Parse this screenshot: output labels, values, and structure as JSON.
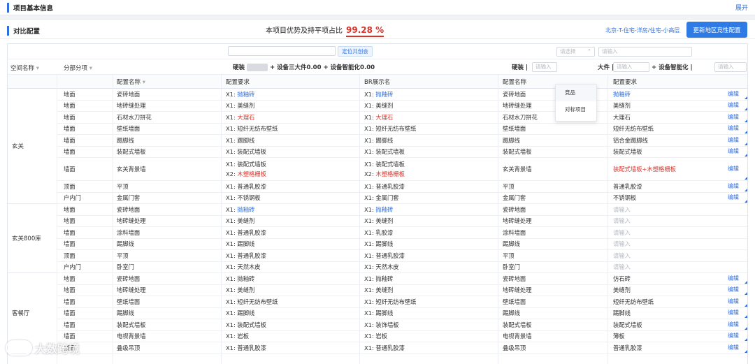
{
  "section": {
    "title": "项目基本信息",
    "expand_label": "展开"
  },
  "compare": {
    "title": "对比配置",
    "ratio_label": "本项目优势及持平项占比",
    "ratio_value": "99.28",
    "ratio_unit": "%",
    "region_link": "北京-T-住宅-洋房/住宅-小高层",
    "update_button": "更新地区竞性配置"
  },
  "filters": {
    "left_input_placeholder": "",
    "locate_button": "定位共创会",
    "select_placeholder": "请选择",
    "right_input_placeholder": "请输入"
  },
  "summary": {
    "left": "硬装",
    "left_rest": "+ 设备三大件0.00 + 设备智能化0.00",
    "right_hard": "硬装 |",
    "right_hard_input": "请输入",
    "right_mid": "大件 |",
    "right_mid_input": "请输入",
    "right_smart": "+ 设备智能化 |",
    "right_smart_input": "请输入"
  },
  "dropdown": {
    "options": [
      "竞品",
      "对标项目"
    ]
  },
  "columns": {
    "space": "空间名称",
    "part": "分部分项",
    "name": "配置名称",
    "req": "配置要求",
    "br": "BR展示名",
    "cmp_name": "配置名称",
    "cmp_req": "配置要求"
  },
  "groups": [
    {
      "space": "玄关",
      "rows": [
        {
          "part": "地面",
          "name": "瓷砖地面",
          "req": [
            "X1: 抛釉砖"
          ],
          "br": [
            "X1: 抛釉砖"
          ],
          "cmp_name": "瓷砖地面",
          "cmp_req": "抛釉砖",
          "tone": "blue",
          "edit": "编辑"
        },
        {
          "part": "地面",
          "name": "地砖缝处理",
          "req": [
            "X1: 美缝剂"
          ],
          "br": [
            "X1: 美缝剂"
          ],
          "cmp_name": "地砖缝处理",
          "cmp_req": "美缝剂",
          "tone": "",
          "edit": "编辑"
        },
        {
          "part": "地面",
          "name": "石材水刀拼花",
          "req": [
            "X1: 大理石"
          ],
          "br": [
            "X1: 大理石"
          ],
          "cmp_name": "石材水刀拼花",
          "cmp_req": "大理石",
          "tone": "red",
          "edit": "编辑"
        },
        {
          "part": "墙面",
          "name": "壁纸墙面",
          "req": [
            "X1: 短纤无纺布壁纸"
          ],
          "br": [
            "X1: 短纤无纺布壁纸"
          ],
          "cmp_name": "壁纸墙面",
          "cmp_req": "短纤无纺布壁纸",
          "tone": "",
          "edit": "编辑"
        },
        {
          "part": "墙面",
          "name": "踢脚线",
          "req": [
            "X1: 踢脚线"
          ],
          "br": [
            "X1: 踢脚线"
          ],
          "cmp_name": "踢脚线",
          "cmp_req": "铝合金踢脚线",
          "tone": "",
          "edit": "编辑"
        },
        {
          "part": "墙面",
          "name": "装配式墙板",
          "req": [
            "X1: 装配式墙板"
          ],
          "br": [
            "X1: 装配式墙板"
          ],
          "cmp_name": "装配式墙板",
          "cmp_req": "装配式墙板",
          "tone": "",
          "edit": "编辑"
        },
        {
          "part": "墙面",
          "name": "玄关背景墙",
          "req": [
            "X1: 装配式墙板",
            "X2: 木塑格栅板"
          ],
          "br": [
            "X1: 装配式墙板",
            "X2: 木塑格栅板"
          ],
          "cmp_name": "玄关背景墙",
          "cmp_req": "装配式墙板+木塑格栅板",
          "tone": "red2",
          "edit": "编辑"
        },
        {
          "part": "顶面",
          "name": "平顶",
          "req": [
            "X1: 普通乳胶漆"
          ],
          "br": [
            "X1: 普通乳胶漆"
          ],
          "cmp_name": "平顶",
          "cmp_req": "普通乳胶漆",
          "tone": "",
          "edit": "编辑"
        },
        {
          "part": "户内门",
          "name": "金属门套",
          "req": [
            "X1: 不锈钢板"
          ],
          "br": [
            "X1: 金属门套"
          ],
          "cmp_name": "金属门套",
          "cmp_req": "不锈钢板",
          "tone": "",
          "edit": "编辑"
        }
      ]
    },
    {
      "space": "玄关800库",
      "rows": [
        {
          "part": "地面",
          "name": "瓷砖地面",
          "req": [
            "X1: 抛釉砖"
          ],
          "br": [
            "X1: 抛釉砖"
          ],
          "cmp_name": "瓷砖地面",
          "cmp_req": "请输入",
          "tone": "blue",
          "edit": ""
        },
        {
          "part": "地面",
          "name": "地砖缝处理",
          "req": [
            "X1: 美缝剂"
          ],
          "br": [
            "X1: 美缝剂"
          ],
          "cmp_name": "地砖缝处理",
          "cmp_req": "请输入",
          "tone": "",
          "edit": ""
        },
        {
          "part": "墙面",
          "name": "涂料墙面",
          "req": [
            "X1: 普通乳胶漆"
          ],
          "br": [
            "X1: 乳胶漆"
          ],
          "cmp_name": "涂料墙面",
          "cmp_req": "请输入",
          "tone": "",
          "edit": ""
        },
        {
          "part": "墙面",
          "name": "踢脚线",
          "req": [
            "X1: 踢脚线"
          ],
          "br": [
            "X1: 踢脚线"
          ],
          "cmp_name": "踢脚线",
          "cmp_req": "请输入",
          "tone": "",
          "edit": ""
        },
        {
          "part": "顶面",
          "name": "平顶",
          "req": [
            "X1: 普通乳胶漆"
          ],
          "br": [
            "X1: 普通乳胶漆"
          ],
          "cmp_name": "平顶",
          "cmp_req": "请输入",
          "tone": "",
          "edit": ""
        },
        {
          "part": "户内门",
          "name": "卧室门",
          "req": [
            "X1: 天然木皮"
          ],
          "br": [
            "X1: 天然木皮"
          ],
          "cmp_name": "卧室门",
          "cmp_req": "请输入",
          "tone": "",
          "edit": ""
        }
      ]
    },
    {
      "space": "客餐厅",
      "rows": [
        {
          "part": "地面",
          "name": "瓷砖地面",
          "req": [
            "X1: 抛釉砖"
          ],
          "br": [
            "X1: 抛釉砖"
          ],
          "cmp_name": "瓷砖地面",
          "cmp_req": "仿石砖",
          "tone": "",
          "edit": "编辑"
        },
        {
          "part": "地面",
          "name": "地砖缝处理",
          "req": [
            "X1: 美缝剂"
          ],
          "br": [
            "X1: 美缝剂"
          ],
          "cmp_name": "地砖缝处理",
          "cmp_req": "美缝剂",
          "tone": "",
          "edit": "编辑"
        },
        {
          "part": "墙面",
          "name": "壁纸墙面",
          "req": [
            "X1: 短纤无纺布壁纸"
          ],
          "br": [
            "X1: 短纤无纺布壁纸"
          ],
          "cmp_name": "壁纸墙面",
          "cmp_req": "短纤无纺布壁纸",
          "tone": "",
          "edit": "编辑"
        },
        {
          "part": "墙面",
          "name": "踢脚线",
          "req": [
            "X1: 踢脚线"
          ],
          "br": [
            "X1: 踢脚线"
          ],
          "cmp_name": "踢脚线",
          "cmp_req": "踢脚线",
          "tone": "",
          "edit": "编辑"
        },
        {
          "part": "墙面",
          "name": "装配式墙板",
          "req": [
            "X1: 装配式墙板"
          ],
          "br": [
            "X1: 装饰墙板"
          ],
          "cmp_name": "装配式墙板",
          "cmp_req": "装配式墙板",
          "tone": "",
          "edit": "编辑"
        },
        {
          "part": "墙面",
          "name": "电视背景墙",
          "req": [
            "X1: 岩板"
          ],
          "br": [
            "X1: 岩板"
          ],
          "cmp_name": "电视背景墙",
          "cmp_req": "薄板",
          "tone": "",
          "edit": "编辑"
        },
        {
          "part": "顶面",
          "name": "叠级吊顶",
          "req": [
            "X1: 普通乳胶漆"
          ],
          "br": [
            "X1: 普通乳胶漆"
          ],
          "cmp_name": "叠级吊顶",
          "cmp_req": "普通乳胶漆",
          "tone": "",
          "edit": "编辑"
        }
      ]
    }
  ],
  "watermark": "大数跨境"
}
